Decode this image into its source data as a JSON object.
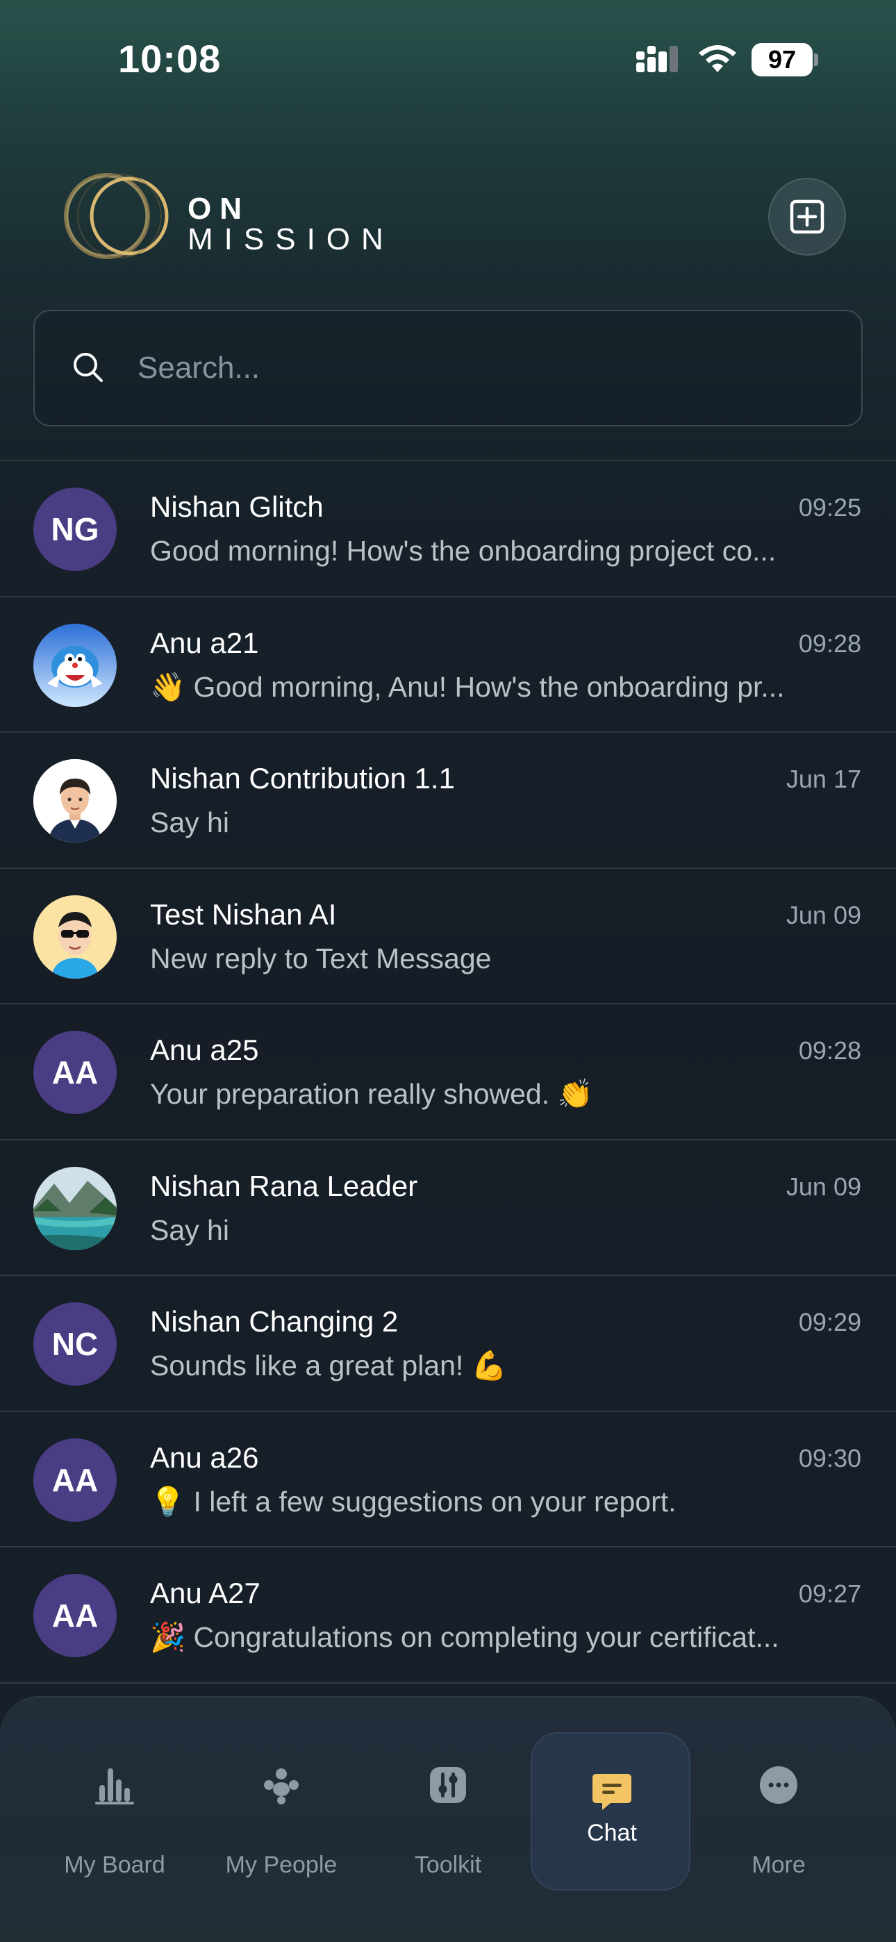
{
  "status_bar": {
    "time": "10:08",
    "battery": "97"
  },
  "brand": {
    "line1": "ON",
    "line2": "MISSION"
  },
  "search": {
    "placeholder": "Search..."
  },
  "chats": [
    {
      "name": "Nishan  Glitch",
      "time": "09:25",
      "message": "Good morning! How's the onboarding project co...",
      "avatar": {
        "type": "initials",
        "text": "NG"
      }
    },
    {
      "name": "Anu a21",
      "time": "09:28",
      "message": "👋 Good morning, Anu! How's the onboarding pr...",
      "avatar": {
        "type": "image",
        "icon": "robot-cat-avatar"
      }
    },
    {
      "name": "Nishan Contribution 1.1",
      "time": "Jun 17",
      "message": "Say hi",
      "avatar": {
        "type": "image",
        "icon": "man-avatar"
      }
    },
    {
      "name": "Test Nishan  AI",
      "time": "Jun 09",
      "message": "New reply to Text Message",
      "avatar": {
        "type": "image",
        "icon": "sunglasses-avatar"
      }
    },
    {
      "name": "Anu a25",
      "time": "09:28",
      "message": "Your preparation really showed. 👏",
      "avatar": {
        "type": "initials",
        "text": "AA"
      }
    },
    {
      "name": "Nishan Rana Leader",
      "time": "Jun 09",
      "message": "Say hi",
      "avatar": {
        "type": "image",
        "icon": "landscape-avatar"
      }
    },
    {
      "name": "Nishan Changing 2",
      "time": "09:29",
      "message": "Sounds like a great plan! 💪",
      "avatar": {
        "type": "initials",
        "text": "NC"
      }
    },
    {
      "name": "Anu a26",
      "time": "09:30",
      "message": "💡 I left a few suggestions on your report.",
      "avatar": {
        "type": "initials",
        "text": "AA"
      }
    },
    {
      "name": "Anu A27",
      "time": "09:27",
      "message": "🎉 Congratulations on completing your certificat...",
      "avatar": {
        "type": "initials",
        "text": "AA"
      }
    }
  ],
  "tabs": [
    {
      "label": "My Board",
      "icon": "bar-chart-icon",
      "active": false
    },
    {
      "label": "My People",
      "icon": "people-icon",
      "active": false
    },
    {
      "label": "Toolkit",
      "icon": "sliders-icon",
      "active": false
    },
    {
      "label": "Chat",
      "icon": "chat-bubble-icon",
      "active": true
    },
    {
      "label": "More",
      "icon": "more-dots-icon",
      "active": false
    }
  ],
  "colors": {
    "accent": "#f2c463",
    "avatar_bg": "#4a3d84",
    "logo_gold": "#d9b870"
  }
}
